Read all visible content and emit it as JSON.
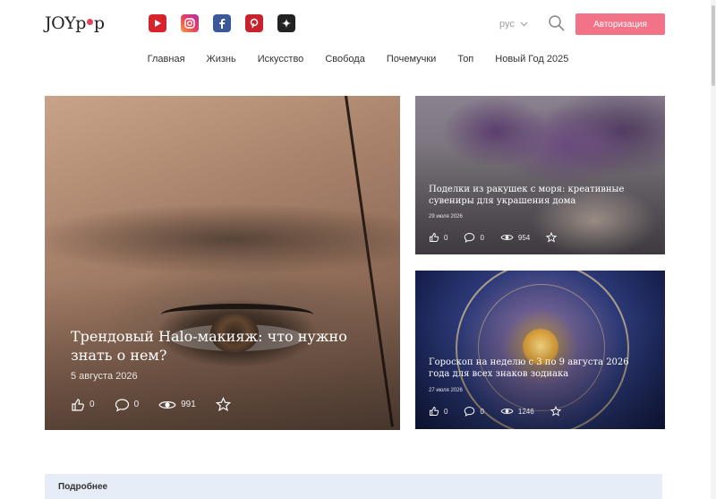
{
  "header": {
    "logo_text_a": "JOY",
    "logo_text_b": "p",
    "logo_text_c": "p",
    "socials": [
      {
        "name": "youtube",
        "icon": "youtube-icon",
        "color": "#d7232a"
      },
      {
        "name": "instagram",
        "icon": "instagram-icon",
        "color": "#e4405f"
      },
      {
        "name": "facebook",
        "icon": "facebook-icon",
        "color": "#3b5998"
      },
      {
        "name": "pinterest",
        "icon": "pinterest-icon",
        "color": "#c8232c"
      },
      {
        "name": "dzen",
        "icon": "dzen-icon",
        "color": "#222222"
      }
    ],
    "language": "рус",
    "auth_label": "Авторизация",
    "accent_color": "#f27288"
  },
  "nav": [
    {
      "label": "Главная"
    },
    {
      "label": "Жизнь"
    },
    {
      "label": "Искусство"
    },
    {
      "label": "Свобода"
    },
    {
      "label": "Почемучки"
    },
    {
      "label": "Топ"
    },
    {
      "label": "Новый Год 2025"
    }
  ],
  "featured": {
    "title": "Трендовый Halo-макияж: что нужно знать о нем?",
    "date": "5 августа 2026",
    "likes": "0",
    "comments": "0",
    "views": "991"
  },
  "side_cards": [
    {
      "title": "Поделки из ракушек с моря: креативные сувениры для украшения дома",
      "date": "29 июля 2026",
      "likes": "0",
      "comments": "0",
      "views": "954"
    },
    {
      "title": "Гороскоп на неделю с 3 по 9 августа 2026 года для всех знаков зодиака",
      "date": "27 июля 2026",
      "likes": "0",
      "comments": "0",
      "views": "1246"
    }
  ],
  "more": {
    "label": "Подробнее"
  }
}
